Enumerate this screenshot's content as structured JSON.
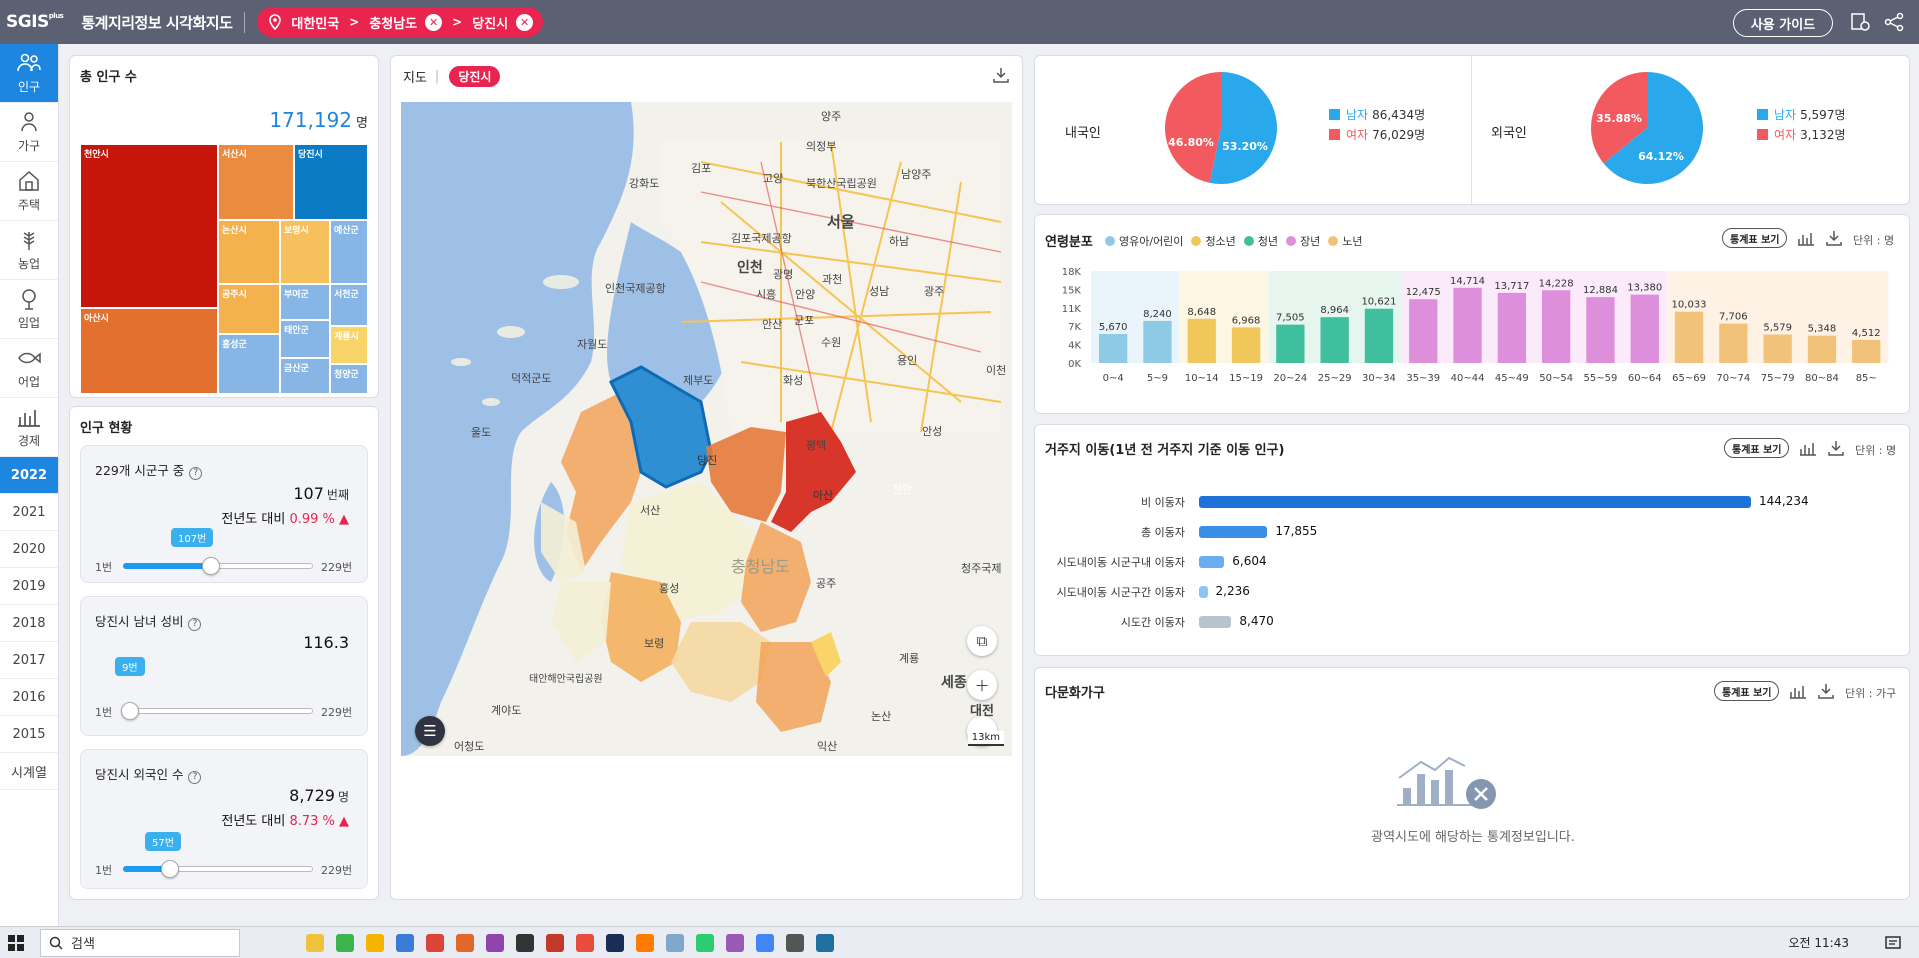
{
  "header": {
    "logo": "SGIS",
    "logo_sub": "plus",
    "app_title": "통계지리정보 시각화지도",
    "breadcrumb": [
      "대한민국",
      "충청남도",
      "당진시"
    ],
    "guide_button": "사용 가이드"
  },
  "nav": {
    "items": [
      {
        "label": "인구",
        "icon": "people-icon",
        "active": true
      },
      {
        "label": "가구",
        "icon": "household-icon",
        "active": false
      },
      {
        "label": "주택",
        "icon": "house-icon",
        "active": false
      },
      {
        "label": "농업",
        "icon": "farm-icon",
        "active": false
      },
      {
        "label": "임업",
        "icon": "forest-icon",
        "active": false
      },
      {
        "label": "어업",
        "icon": "fish-icon",
        "active": false
      },
      {
        "label": "경제",
        "icon": "economy-icon",
        "active": false
      }
    ],
    "years": [
      "2022",
      "2021",
      "2020",
      "2019",
      "2018",
      "2017",
      "2016",
      "2015",
      "시계열"
    ],
    "active_year": "2022"
  },
  "total_population": {
    "title": "총 인구 수",
    "value": "171,192",
    "unit": "명",
    "treemap": [
      {
        "name": "천안시",
        "color": "#c8150a"
      },
      {
        "name": "아산시",
        "color": "#e3702f"
      },
      {
        "name": "서산시",
        "color": "#ea8c3f"
      },
      {
        "name": "당진시",
        "color": "#0a7bc4"
      },
      {
        "name": "논산시",
        "color": "#f3b24d"
      },
      {
        "name": "보령시",
        "color": "#f6c15c"
      },
      {
        "name": "예산군",
        "color": "#86b5e6"
      },
      {
        "name": "공주시",
        "color": "#f3b24d"
      },
      {
        "name": "부여군",
        "color": "#86b5e6"
      },
      {
        "name": "서천군",
        "color": "#86b5e6"
      },
      {
        "name": "태안군",
        "color": "#86b5e6"
      },
      {
        "name": "홍성군",
        "color": "#86b5e6"
      },
      {
        "name": "계룡시",
        "color": "#f9d468"
      },
      {
        "name": "금산군",
        "color": "#86b5e6"
      },
      {
        "name": "청양군",
        "color": "#86b5e6"
      }
    ]
  },
  "status": {
    "title": "인구 현황",
    "cards": [
      {
        "title": "229개 시군구 중",
        "value": "107",
        "value_unit": "번째",
        "delta_label": "전년도 대비",
        "delta": "0.99 % ▲",
        "bubble": "107번",
        "min": "1번",
        "max": "229번",
        "rank": 107,
        "total": 229
      },
      {
        "title": "당진시 남녀 성비",
        "value": "116.3",
        "value_unit": "",
        "delta_label": "",
        "delta": "",
        "bubble": "9번",
        "min": "1번",
        "max": "229번",
        "rank": 9,
        "total": 229
      },
      {
        "title": "당진시 외국인 수",
        "value": "8,729",
        "value_unit": "명",
        "delta_label": "전년도 대비",
        "delta": "8.73 % ▲",
        "bubble": "57번",
        "min": "1번",
        "max": "229번",
        "rank": 57,
        "total": 229
      }
    ]
  },
  "map": {
    "tab": "지도",
    "region_pill": "당진시",
    "scale": "13km",
    "labels": [
      "양주",
      "의정부",
      "남양주",
      "김포",
      "고양",
      "북한산국립공원",
      "서울",
      "하남",
      "강화도",
      "김포국제공항",
      "인천",
      "광명",
      "과천",
      "성남",
      "광주",
      "인천국제공항",
      "시흥",
      "안양",
      "자월도",
      "안산",
      "군포",
      "수원",
      "덕적군도",
      "화성",
      "용인",
      "제부도",
      "이천",
      "울도",
      "평택",
      "안성",
      "당진",
      "아산",
      "천안",
      "서산",
      "태안해안국립공원",
      "충청남도",
      "홍성",
      "세종",
      "청주국제",
      "공주",
      "보령",
      "계룡",
      "대전",
      "논산",
      "어청도",
      "익산",
      "계야도"
    ]
  },
  "pies": {
    "domestic": {
      "title": "내국인",
      "male_label": "남자",
      "male_value": "86,434명",
      "female_label": "여자",
      "female_value": "76,029명",
      "male_pct": "53.20%",
      "female_pct": "46.80%",
      "male_frac": 0.532
    },
    "foreign": {
      "title": "외국인",
      "male_label": "남자",
      "male_value": "5,597명",
      "female_label": "여자",
      "female_value": "3,132명",
      "male_pct": "64.12%",
      "female_pct": "35.88%",
      "male_frac": 0.6412
    }
  },
  "age": {
    "title": "연령분포",
    "legend": [
      {
        "name": "영유아/어린이",
        "color": "#8ecae6"
      },
      {
        "name": "청소년",
        "color": "#f1c75b"
      },
      {
        "name": "청년",
        "color": "#3fbf9e"
      },
      {
        "name": "장년",
        "color": "#dd8fdc"
      },
      {
        "name": "노년",
        "color": "#f3c27a"
      }
    ],
    "button": "통계표 보기",
    "unit": "단위 : 명"
  },
  "chart_data": {
    "type": "bar",
    "categories": [
      "0~4",
      "5~9",
      "10~14",
      "15~19",
      "20~24",
      "25~29",
      "30~34",
      "35~39",
      "40~44",
      "45~49",
      "50~54",
      "55~59",
      "60~64",
      "65~69",
      "70~74",
      "75~79",
      "80~84",
      "85~"
    ],
    "values": [
      5670,
      8240,
      8648,
      6968,
      7505,
      8964,
      10621,
      12475,
      14714,
      13717,
      14228,
      12884,
      13380,
      10033,
      7706,
      5579,
      5348,
      4512
    ],
    "value_labels": [
      "5,670",
      "8,240",
      "8,648",
      "6,968",
      "7,505",
      "8,964",
      "10,621",
      "12,475",
      "14,714",
      "13,717",
      "14,228",
      "12,884",
      "13,380",
      "10,033",
      "7,706",
      "5,579",
      "5,348",
      "4,512"
    ],
    "groups": [
      0,
      0,
      1,
      1,
      2,
      2,
      2,
      3,
      3,
      3,
      3,
      3,
      3,
      4,
      4,
      4,
      4,
      4
    ],
    "ytick_labels": [
      "18K",
      "15K",
      "11K",
      "7K",
      "4K",
      "0K"
    ],
    "ylim": [
      0,
      18000
    ]
  },
  "migration": {
    "title": "거주지 이동(1년 전 거주지 기준 이동 인구)",
    "button": "통계표 보기",
    "unit": "단위 : 명",
    "rows": [
      {
        "label": "비 이동자",
        "value": 144234,
        "text": "144,234",
        "color": "#1d72d8"
      },
      {
        "label": "총 이동자",
        "value": 17855,
        "text": "17,855",
        "color": "#3a8ee6"
      },
      {
        "label": "시도내이동 시군구내 이동자",
        "value": 6604,
        "text": "6,604",
        "color": "#6aaef0"
      },
      {
        "label": "시도내이동 시군구간 이동자",
        "value": 2236,
        "text": "2,236",
        "color": "#8ec4f4"
      },
      {
        "label": "시도간 이동자",
        "value": 8470,
        "text": "8,470",
        "color": "#b9c3cf"
      }
    ]
  },
  "multicultural": {
    "title": "다문화가구",
    "button": "통계표 보기",
    "unit": "단위 : 가구",
    "empty_message": "광역시도에 해당하는 통계정보입니다."
  },
  "taskbar": {
    "search": "검색",
    "clock": "오전 11:43"
  }
}
